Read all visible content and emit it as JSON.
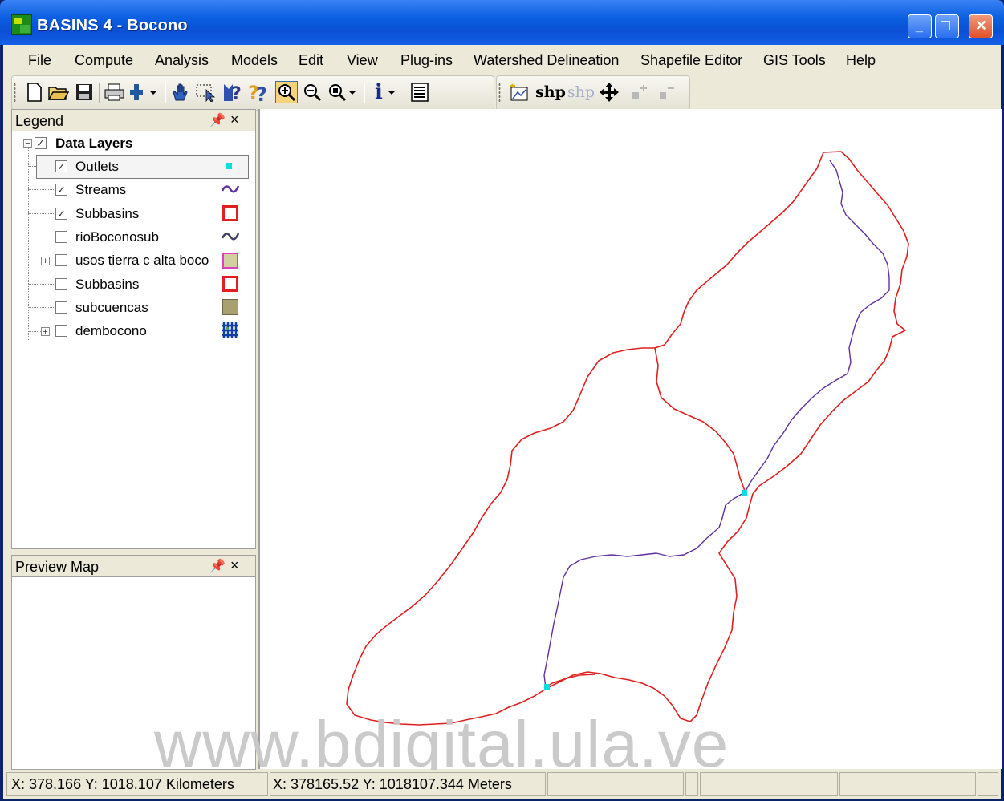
{
  "window": {
    "title": "BASINS 4   - Bocono",
    "minimize_glyph": "_",
    "maximize_glyph": "□",
    "close_glyph": "✕"
  },
  "menu": [
    "File",
    "Compute",
    "Analysis",
    "Models",
    "Edit",
    "View",
    "Plug-ins",
    "Watershed Delineation",
    "Shapefile Editor",
    "GIS Tools",
    "Help"
  ],
  "toolbar": {
    "icons": [
      "new-document-icon",
      "open-folder-icon",
      "save-icon",
      "print-icon",
      "add-layer-icon",
      "pan-hand-icon",
      "select-icon",
      "identify-icon",
      "query-icon",
      "zoom-in-icon",
      "zoom-out-icon",
      "zoom-extent-icon",
      "info-icon",
      "attribute-table-icon"
    ],
    "shapefile_icons": [
      "new-shapefile-icon",
      "add-shape-icon",
      "remove-shape-icon",
      "move-shape-icon",
      "add-vertex-icon",
      "remove-vertex-icon"
    ],
    "shp_add_label": "shp",
    "shp_remove_label": "shp",
    "info_label": "i"
  },
  "legend": {
    "title": "Legend",
    "group_label": "Data Layers",
    "layers": [
      {
        "label": "Outlets",
        "checked": true,
        "symbol": "cyan-point",
        "color": "#00e0e0"
      },
      {
        "label": "Streams",
        "checked": true,
        "symbol": "line",
        "color": "#6030a0"
      },
      {
        "label": "Subbasins",
        "checked": true,
        "symbol": "polygon-outline",
        "color": "#e02020"
      },
      {
        "label": "rioBoconosub",
        "checked": false,
        "symbol": "line",
        "color": "#404060"
      },
      {
        "label": "usos tierra c alta boco",
        "checked": false,
        "symbol": "polygon-fill",
        "color": "#d0a0c8"
      },
      {
        "label": "Subbasins",
        "checked": false,
        "symbol": "polygon-outline",
        "color": "#e02020"
      },
      {
        "label": "subcuencas",
        "checked": false,
        "symbol": "polygon-fill",
        "color": "#a8a070"
      },
      {
        "label": "dembocono",
        "checked": false,
        "symbol": "grid",
        "color": "#1040a0"
      }
    ]
  },
  "preview": {
    "title": "Preview Map"
  },
  "map": {
    "watermark": "www.bdigital.ula.ve",
    "subbasin_color": "#e02020",
    "stream_color": "#6030a0",
    "outlet_color": "#00e0e0"
  },
  "status": {
    "km": "X: 378.166    Y: 1018.107 Kilometers",
    "m": "X: 378165.52    Y: 1018107.344 Meters"
  }
}
